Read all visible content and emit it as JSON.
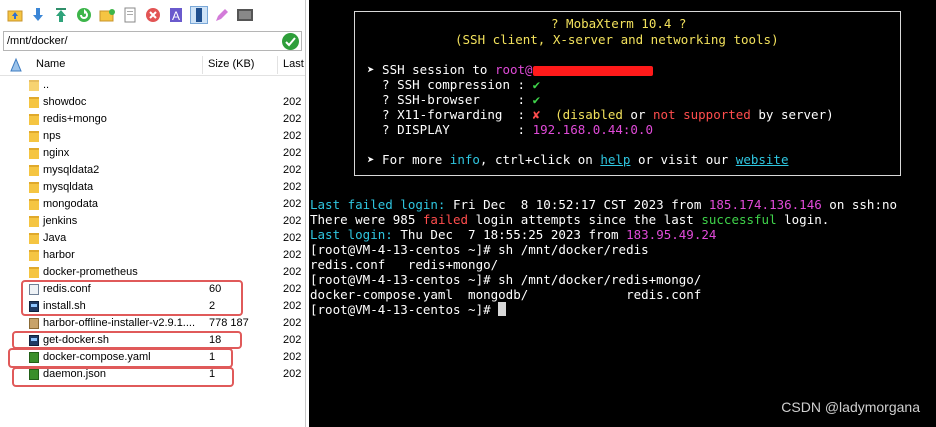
{
  "sftp": {
    "toolbar_icons": [
      "folder-up-icon",
      "download-icon",
      "upload-icon",
      "refresh-icon",
      "new-folder-icon",
      "new-file-icon",
      "delete-icon",
      "rename-icon",
      "permissions-icon",
      "edit-icon",
      "terminal-icon"
    ],
    "path": "/mnt/docker/",
    "columns": {
      "name": "Name",
      "size": "Size (KB)",
      "date": "Last"
    },
    "rows": [
      {
        "name": "..",
        "size": "",
        "date": "",
        "type": "folder"
      },
      {
        "name": "showdoc",
        "size": "",
        "date": "202",
        "type": "folder"
      },
      {
        "name": "redis+mongo",
        "size": "",
        "date": "202",
        "type": "folder"
      },
      {
        "name": "nps",
        "size": "",
        "date": "202",
        "type": "folder"
      },
      {
        "name": "nginx",
        "size": "",
        "date": "202",
        "type": "folder"
      },
      {
        "name": "mysqldata2",
        "size": "",
        "date": "202",
        "type": "folder"
      },
      {
        "name": "mysqldata",
        "size": "",
        "date": "202",
        "type": "folder"
      },
      {
        "name": "mongodata",
        "size": "",
        "date": "202",
        "type": "folder"
      },
      {
        "name": "jenkins",
        "size": "",
        "date": "202",
        "type": "folder"
      },
      {
        "name": "Java",
        "size": "",
        "date": "202",
        "type": "folder"
      },
      {
        "name": "harbor",
        "size": "",
        "date": "202",
        "type": "folder"
      },
      {
        "name": "docker-prometheus",
        "size": "",
        "date": "202",
        "type": "folder"
      },
      {
        "name": "redis.conf",
        "size": "60",
        "date": "202",
        "type": "conf"
      },
      {
        "name": "install.sh",
        "size": "2",
        "date": "202",
        "type": "sh"
      },
      {
        "name": "harbor-offline-installer-v2.9.1....",
        "size": "778 187",
        "date": "202",
        "type": "tar"
      },
      {
        "name": "get-docker.sh",
        "size": "18",
        "date": "202",
        "type": "sh"
      },
      {
        "name": "docker-compose.yaml",
        "size": "1",
        "date": "202",
        "type": "yaml"
      },
      {
        "name": "daemon.json",
        "size": "1",
        "date": "202",
        "type": "json"
      }
    ]
  },
  "terminal": {
    "banner": {
      "title": "? MobaXterm 10.4 ?",
      "subtitle": "(SSH client, X-server and networking tools)",
      "session_prefix": "➤ SSH session to ",
      "session_user": "root@",
      "compression_label": "  ? SSH compression : ",
      "browser_label": "  ? SSH-browser     : ",
      "x11_label": "  ? X11-forwarding  : ",
      "x11_mark": "✘",
      "x11_paren_open": "  (disabled ",
      "x11_or": "or ",
      "x11_not_supported": "not supported",
      "x11_tail": " by server)",
      "display_label": "  ? DISPLAY         : ",
      "display_value": "192.168.0.44:0.0",
      "check_mark": "✔",
      "more_prefix": "➤ For more ",
      "more_info": "info",
      "more_mid": ", ctrl+click on ",
      "more_help": "help",
      "more_or": " or visit our ",
      "more_website": "website"
    },
    "failed": {
      "label": "Last failed login:",
      "date": " Fri Dec  8 10:52:17 CST 2023 from ",
      "ip": "185.174.136.146",
      "tail": " on ssh:no"
    },
    "attempts": {
      "a": "There were 985 ",
      "failed": "failed",
      "b": " login attempts since the last ",
      "successful": "successful",
      "c": " login."
    },
    "last": {
      "label": "Last login:",
      "date": " Thu Dec  7 18:55:25 2023 from ",
      "ip": "183.95.49.24"
    },
    "lines": [
      "[root@VM-4-13-centos ~]# sh /mnt/docker/redis",
      "redis.conf   redis+mongo/",
      "[root@VM-4-13-centos ~]# sh /mnt/docker/redis+mongo/",
      "docker-compose.yaml  mongodb/             redis.conf"
    ],
    "prompt": "[root@VM-4-13-centos ~]# "
  },
  "watermark": "CSDN @ladymorgana",
  "colors": {
    "highlight": "#e05a5a",
    "terminal_bg": "#000000",
    "cyan": "#2fc6e0",
    "magenta": "#e04ad8",
    "green": "#3fd34a",
    "red": "#ff4d4d"
  }
}
